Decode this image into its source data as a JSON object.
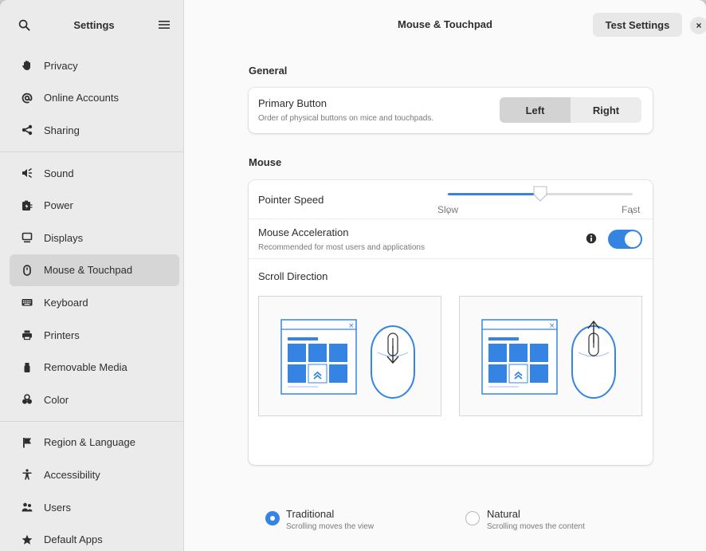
{
  "sidebar": {
    "title": "Settings",
    "groups": [
      [
        {
          "label": "Privacy",
          "icon": "hand-icon"
        },
        {
          "label": "Online Accounts",
          "icon": "at-icon"
        },
        {
          "label": "Sharing",
          "icon": "share-icon"
        }
      ],
      [
        {
          "label": "Sound",
          "icon": "speaker-icon"
        },
        {
          "label": "Power",
          "icon": "battery-icon"
        },
        {
          "label": "Displays",
          "icon": "monitor-icon"
        },
        {
          "label": "Mouse & Touchpad",
          "icon": "mouse-icon",
          "active": true
        },
        {
          "label": "Keyboard",
          "icon": "keyboard-icon"
        },
        {
          "label": "Printers",
          "icon": "printer-icon"
        },
        {
          "label": "Removable Media",
          "icon": "usb-icon"
        },
        {
          "label": "Color",
          "icon": "color-icon"
        }
      ],
      [
        {
          "label": "Region & Language",
          "icon": "flag-icon"
        },
        {
          "label": "Accessibility",
          "icon": "accessibility-icon"
        },
        {
          "label": "Users",
          "icon": "users-icon"
        },
        {
          "label": "Default Apps",
          "icon": "star-icon"
        }
      ]
    ]
  },
  "header": {
    "title": "Mouse & Touchpad",
    "test_button": "Test Settings",
    "close_glyph": "×"
  },
  "general": {
    "section_title": "General",
    "primary_button": {
      "title": "Primary Button",
      "subtitle": "Order of physical buttons on mice and touchpads.",
      "options": [
        "Left",
        "Right"
      ],
      "selected": "Left"
    }
  },
  "mouse": {
    "section_title": "Mouse",
    "pointer_speed": {
      "title": "Pointer Speed",
      "min_label": "Slow",
      "max_label": "Fast",
      "value": 0.5
    },
    "acceleration": {
      "title": "Mouse Acceleration",
      "subtitle": "Recommended for most users and applications",
      "enabled": true
    },
    "scroll_direction": {
      "title": "Scroll Direction",
      "options": [
        {
          "title": "Traditional",
          "subtitle": "Scrolling moves the view",
          "selected": true
        },
        {
          "title": "Natural",
          "subtitle": "Scrolling moves the content",
          "selected": false
        }
      ]
    }
  },
  "colors": {
    "accent": "#3584e4",
    "sidebar_bg": "#ebebeb",
    "active_item": "#d6d6d6"
  }
}
